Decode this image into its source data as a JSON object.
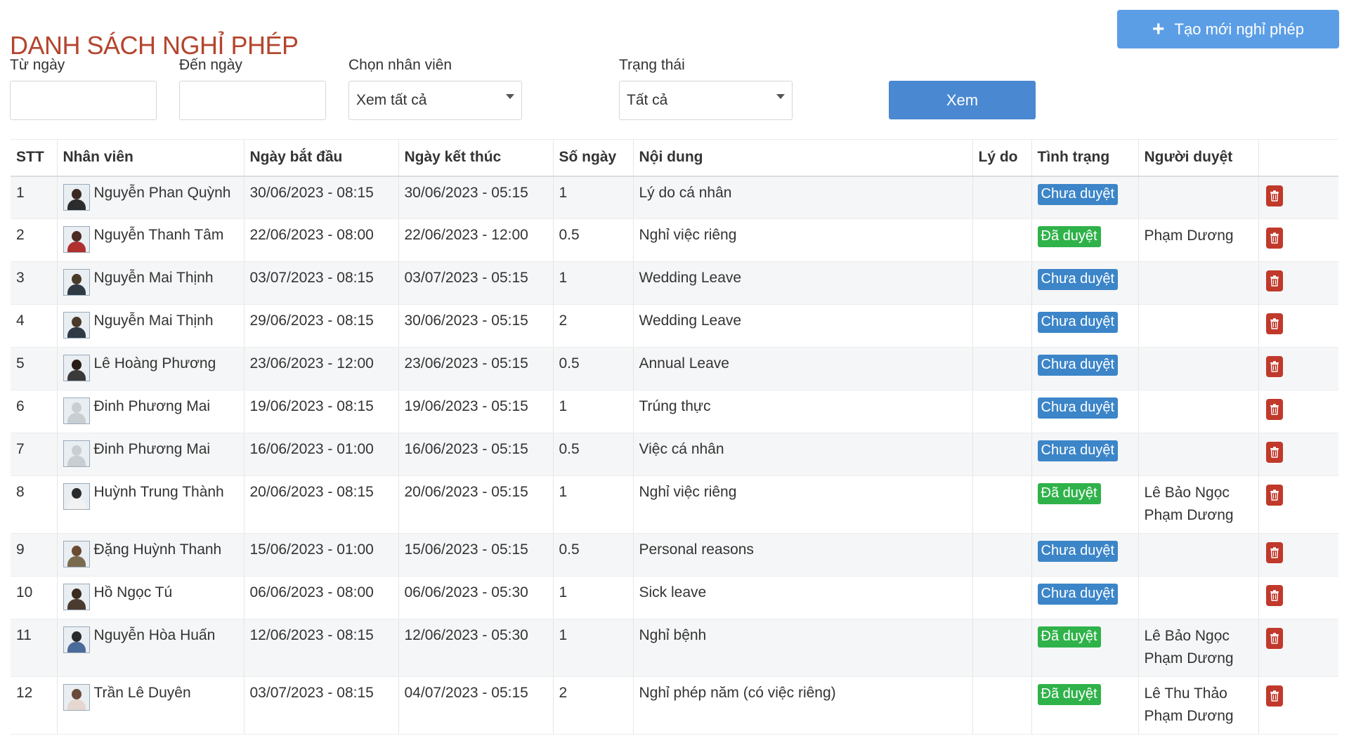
{
  "page": {
    "title": "DANH SÁCH NGHỈ PHÉP",
    "create_button": "Tạo mới nghỉ phép"
  },
  "filters": {
    "from_date": {
      "label": "Từ ngày",
      "value": ""
    },
    "to_date": {
      "label": "Đến ngày",
      "value": ""
    },
    "employee": {
      "label": "Chọn nhân viên",
      "value": "Xem tất cả"
    },
    "status": {
      "label": "Trạng thái",
      "value": "Tất cả"
    },
    "view_button": "Xem"
  },
  "table": {
    "headers": [
      "STT",
      "Nhân viên",
      "Ngày bắt đầu",
      "Ngày kết thúc",
      "Số ngày",
      "Nội dung",
      "Lý do",
      "Tình trạng",
      "Người duyệt",
      ""
    ],
    "rows": [
      {
        "stt": "1",
        "name": "Nguyễn Phan Quỳnh",
        "start": "30/06/2023 - 08:15",
        "end": "30/06/2023 - 05:15",
        "days": "1",
        "content": "Lý do cá nhân",
        "reason": "",
        "status": "Chưa duyệt",
        "approved": false,
        "approvers": []
      },
      {
        "stt": "2",
        "name": "Nguyễn Thanh Tâm",
        "start": "22/06/2023 - 08:00",
        "end": "22/06/2023 - 12:00",
        "days": "0.5",
        "content": "Nghỉ việc riêng",
        "reason": "",
        "status": "Đã duyệt",
        "approved": true,
        "approvers": [
          "Phạm Dương"
        ]
      },
      {
        "stt": "3",
        "name": "Nguyễn Mai Thịnh",
        "start": "03/07/2023 - 08:15",
        "end": "03/07/2023 - 05:15",
        "days": "1",
        "content": "Wedding Leave",
        "reason": "",
        "status": "Chưa duyệt",
        "approved": false,
        "approvers": []
      },
      {
        "stt": "4",
        "name": "Nguyễn Mai Thịnh",
        "start": "29/06/2023 - 08:15",
        "end": "30/06/2023 - 05:15",
        "days": "2",
        "content": "Wedding Leave",
        "reason": "",
        "status": "Chưa duyệt",
        "approved": false,
        "approvers": []
      },
      {
        "stt": "5",
        "name": "Lê Hoàng Phương",
        "start": "23/06/2023 - 12:00",
        "end": "23/06/2023 - 05:15",
        "days": "0.5",
        "content": "Annual Leave",
        "reason": "",
        "status": "Chưa duyệt",
        "approved": false,
        "approvers": []
      },
      {
        "stt": "6",
        "name": "Đinh Phương Mai",
        "start": "19/06/2023 - 08:15",
        "end": "19/06/2023 - 05:15",
        "days": "1",
        "content": "Trúng thực",
        "reason": "",
        "status": "Chưa duyệt",
        "approved": false,
        "approvers": []
      },
      {
        "stt": "7",
        "name": "Đinh Phương Mai",
        "start": "16/06/2023 - 01:00",
        "end": "16/06/2023 - 05:15",
        "days": "0.5",
        "content": "Việc cá nhân",
        "reason": "",
        "status": "Chưa duyệt",
        "approved": false,
        "approvers": []
      },
      {
        "stt": "8",
        "name": "Huỳnh Trung Thành",
        "start": "20/06/2023 - 08:15",
        "end": "20/06/2023 - 05:15",
        "days": "1",
        "content": "Nghỉ việc riêng",
        "reason": "",
        "status": "Đã duyệt",
        "approved": true,
        "approvers": [
          "Lê Bảo Ngọc",
          "Phạm Dương"
        ]
      },
      {
        "stt": "9",
        "name": "Đặng Huỳnh Thanh",
        "start": "15/06/2023 - 01:00",
        "end": "15/06/2023 - 05:15",
        "days": "0.5",
        "content": "Personal reasons",
        "reason": "",
        "status": "Chưa duyệt",
        "approved": false,
        "approvers": []
      },
      {
        "stt": "10",
        "name": "Hồ Ngọc Tú",
        "start": "06/06/2023 - 08:00",
        "end": "06/06/2023 - 05:30",
        "days": "1",
        "content": "Sick leave",
        "reason": "",
        "status": "Chưa duyệt",
        "approved": false,
        "approvers": []
      },
      {
        "stt": "11",
        "name": "Nguyễn Hòa Huấn",
        "start": "12/06/2023 - 08:15",
        "end": "12/06/2023 - 05:30",
        "days": "1",
        "content": "Nghỉ bệnh",
        "reason": "",
        "status": "Đã duyệt",
        "approved": true,
        "approvers": [
          "Lê Bảo Ngọc",
          "Phạm Dương"
        ]
      },
      {
        "stt": "12",
        "name": "Trần Lê Duyên",
        "start": "03/07/2023 - 08:15",
        "end": "04/07/2023 - 05:15",
        "days": "2",
        "content": "Nghỉ phép năm (có việc riêng)",
        "reason": "",
        "status": "Đã duyệt",
        "approved": true,
        "approvers": [
          "Lê Thu Thảo",
          "Phạm Dương"
        ]
      }
    ]
  },
  "colors": {
    "title": "#b4452e",
    "status_pending": "#3c85c8",
    "status_approved": "#2fb24a",
    "delete": "#c0392b",
    "primary": "#4a88d1"
  },
  "icons": {
    "create": "plus-icon",
    "delete": "trash-icon",
    "dropdown": "chevron-down-icon",
    "avatar": "user-avatar"
  }
}
